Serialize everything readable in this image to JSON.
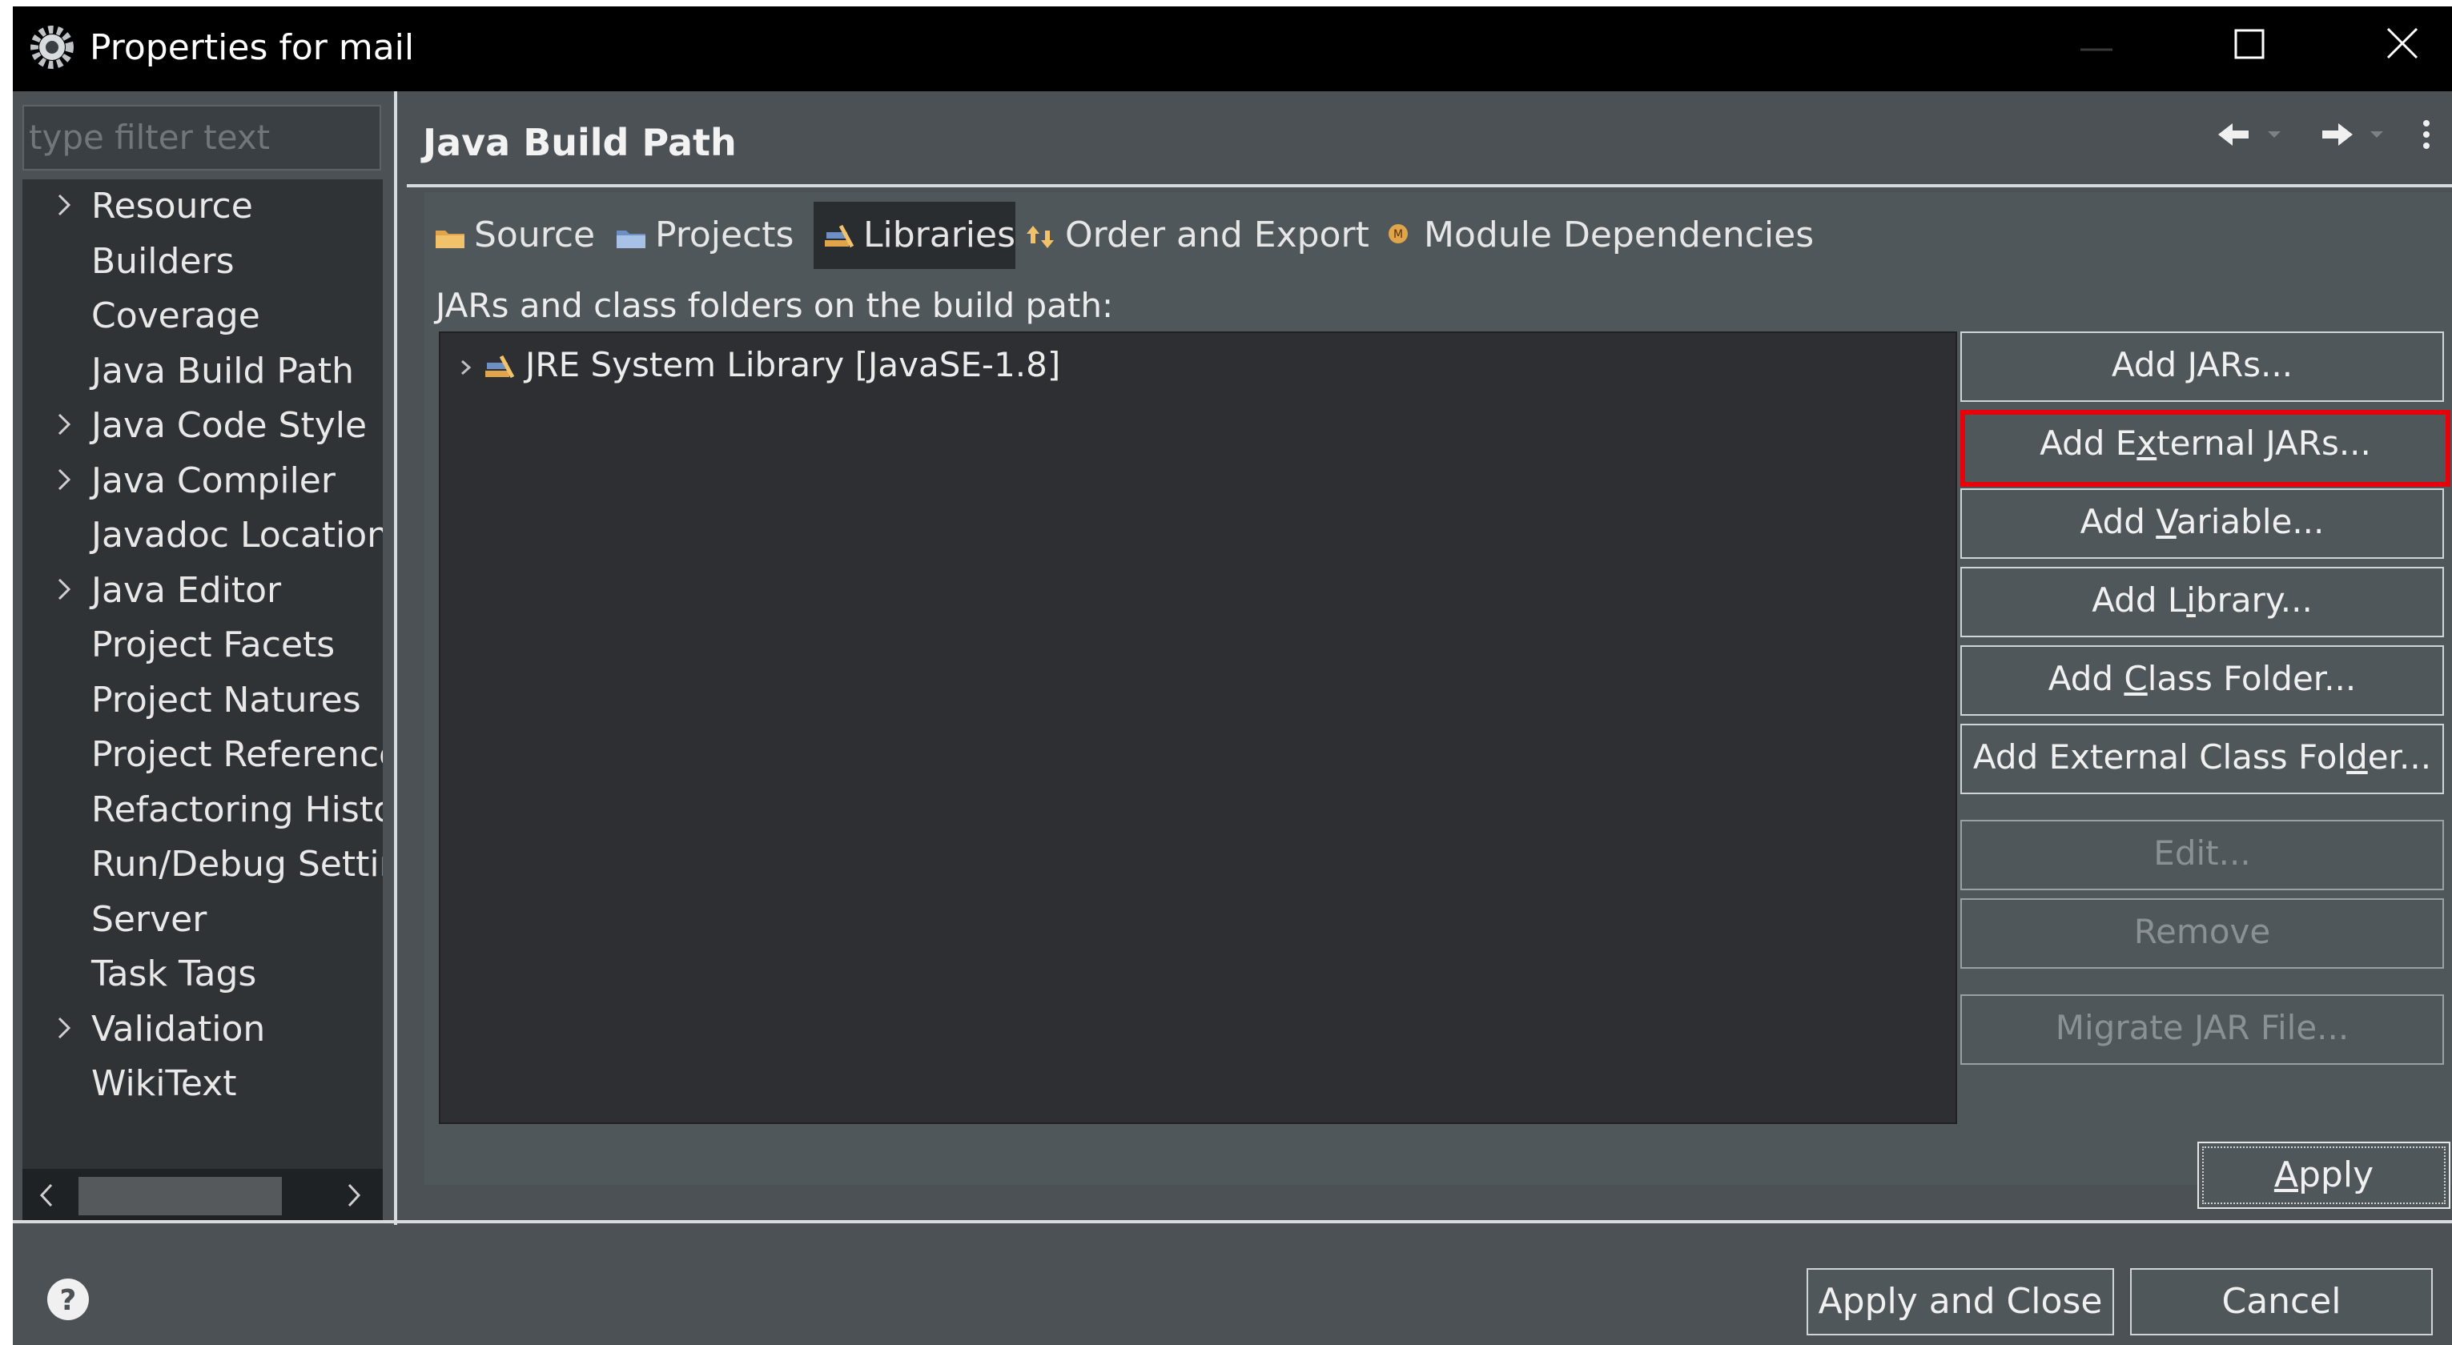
{
  "window": {
    "title": "Properties for mail"
  },
  "sidebar": {
    "filter_placeholder": "type filter text",
    "items": [
      {
        "label": "Resource",
        "expandable": true
      },
      {
        "label": "Builders",
        "expandable": false
      },
      {
        "label": "Coverage",
        "expandable": false
      },
      {
        "label": "Java Build Path",
        "expandable": false
      },
      {
        "label": "Java Code Style",
        "expandable": true
      },
      {
        "label": "Java Compiler",
        "expandable": true
      },
      {
        "label": "Javadoc Location",
        "expandable": false
      },
      {
        "label": "Java Editor",
        "expandable": true
      },
      {
        "label": "Project Facets",
        "expandable": false
      },
      {
        "label": "Project Natures",
        "expandable": false
      },
      {
        "label": "Project References",
        "expandable": false
      },
      {
        "label": "Refactoring History",
        "expandable": false
      },
      {
        "label": "Run/Debug Settings",
        "expandable": false
      },
      {
        "label": "Server",
        "expandable": false
      },
      {
        "label": "Task Tags",
        "expandable": false
      },
      {
        "label": "Validation",
        "expandable": true
      },
      {
        "label": "WikiText",
        "expandable": false
      }
    ]
  },
  "main": {
    "title": "Java Build Path",
    "tabs": [
      {
        "label": "Source",
        "active": false
      },
      {
        "label": "Projects",
        "active": false
      },
      {
        "label": "Libraries",
        "active": true
      },
      {
        "label": "Order and Export",
        "active": false
      },
      {
        "label": "Module Dependencies",
        "active": false
      }
    ],
    "list_label": "JARs and class folders on the build path:",
    "libraries": [
      {
        "label": "JRE System Library [JavaSE-1.8]"
      }
    ],
    "buttons": [
      {
        "name": "add-jars",
        "pre": "Add ",
        "mn": "J",
        "post": "ARs...",
        "enabled": true
      },
      {
        "name": "add-external-jars",
        "pre": "Add E",
        "mn": "x",
        "post": "ternal JARs...",
        "enabled": true,
        "highlighted": true
      },
      {
        "name": "add-variable",
        "pre": "Add ",
        "mn": "V",
        "post": "ariable...",
        "enabled": true
      },
      {
        "name": "add-library",
        "pre": "Add L",
        "mn": "i",
        "post": "brary...",
        "enabled": true
      },
      {
        "name": "add-class-folder",
        "pre": "Add ",
        "mn": "C",
        "post": "lass Folder...",
        "enabled": true
      },
      {
        "name": "add-external-class-folder",
        "pre": "Add External Class Fol",
        "mn": "d",
        "post": "er...",
        "enabled": true
      },
      {
        "name": "edit",
        "pre": "Edit...",
        "mn": "",
        "post": "",
        "enabled": false
      },
      {
        "name": "remove",
        "pre": "Remove",
        "mn": "",
        "post": "",
        "enabled": false
      },
      {
        "name": "migrate-jar-file",
        "pre": "Migrate JAR File...",
        "mn": "",
        "post": "",
        "enabled": false
      }
    ],
    "apply": {
      "mn": "A",
      "post": "pply"
    }
  },
  "footer": {
    "apply_and_close": "Apply and Close",
    "cancel": "Cancel"
  },
  "colors": {
    "highlight": "#e8000b",
    "panel": "#50575b",
    "tree_bg": "#2f3336",
    "title_bg": "#000000"
  }
}
